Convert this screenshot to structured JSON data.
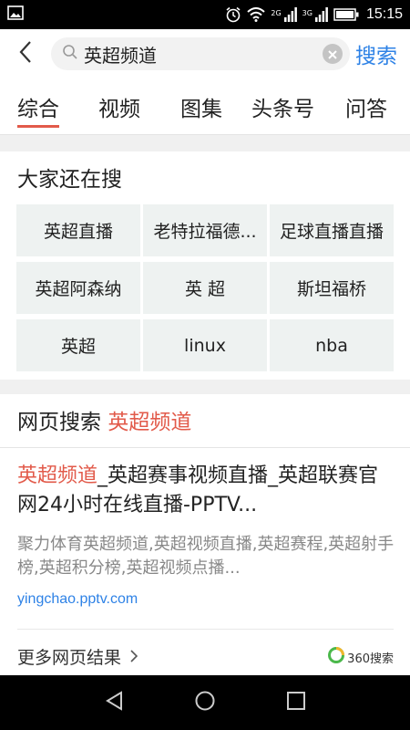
{
  "status_bar": {
    "time": "15:15",
    "network_tag_1": "2G",
    "network_tag_2": "3G",
    "icons": [
      "image-icon",
      "alarm-icon",
      "wifi-icon",
      "signal-icon",
      "battery-icon"
    ]
  },
  "search": {
    "query": "英超频道",
    "submit_label": "搜索"
  },
  "tabs": [
    {
      "label": "综合",
      "active": true
    },
    {
      "label": "视频",
      "active": false
    },
    {
      "label": "图集",
      "active": false
    },
    {
      "label": "头条号",
      "active": false
    },
    {
      "label": "问答",
      "active": false
    }
  ],
  "also_search": {
    "title": "大家还在搜",
    "items": [
      "英超直播",
      "老特拉福德...",
      "足球直播直播",
      "英超阿森纳",
      "英 超",
      "斯坦福桥",
      "英超",
      "linux",
      "nba"
    ]
  },
  "web_results": {
    "title_prefix": "网页搜索",
    "keyword": "英超频道",
    "result": {
      "title_highlight": "英超频道",
      "title_rest": "_英超赛事视频直播_英超联赛官网24小时在线直播-PPTV...",
      "snippet": "聚力体育英超频道,英超视频直播,英超赛程,英超射手榜,英超积分榜,英超视频点播...",
      "url": "yingchao.pptv.com"
    },
    "more_label": "更多网页结果",
    "brand": "360搜索"
  },
  "colors": {
    "accent_blue": "#2e82e6",
    "highlight_red": "#e25a4a"
  }
}
